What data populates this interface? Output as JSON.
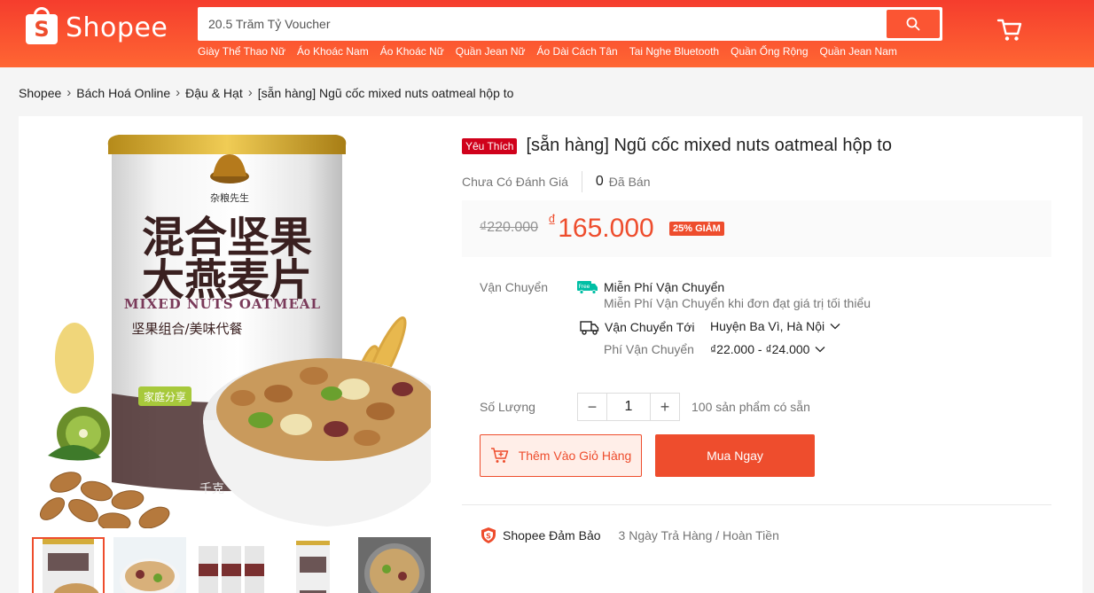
{
  "header": {
    "logo_letter": "S",
    "logo_text": "Shopee",
    "search_placeholder": "20.5 Trăm Tỷ Voucher",
    "keywords": [
      "Giày Thể Thao Nữ",
      "Áo Khoác Nam",
      "Áo Khoác Nữ",
      "Quần Jean Nữ",
      "Áo Dài Cách Tân",
      "Tai Nghe Bluetooth",
      "Quần Ống Rộng",
      "Quần Jean Nam"
    ]
  },
  "breadcrumb": [
    "Shopee",
    "Bách Hoá Online",
    "Đậu & Hạt",
    "[sẵn hàng] Ngũ cốc mixed nuts oatmeal hộp to"
  ],
  "product": {
    "badge": "Yêu Thích",
    "title": "[sẵn hàng] Ngũ cốc mixed nuts oatmeal hộp to",
    "rating_text": "Chưa Có Đánh Giá",
    "sold_count": "0",
    "sold_label": "Đã Bán",
    "old_price": "₫220.000",
    "currency": "₫",
    "new_price": "165.000",
    "discount": "25% GIẢM",
    "image_text": {
      "brand": "杂粮先生",
      "cn_line1": "混合坚果",
      "cn_line2": "大燕麦片",
      "en": "MIXED NUTS OATMEAL",
      "sub": "坚果组合/美味代餐",
      "tag": "家庭分享",
      "weight": "千克"
    }
  },
  "shipping": {
    "label": "Vận Chuyển",
    "free_tag": "Free",
    "free_title": "Miễn Phí Vận Chuyển",
    "free_desc": "Miễn Phí Vận Chuyển khi đơn đạt giá trị tối thiểu",
    "to_label": "Vận Chuyển Tới",
    "to_value": "Huyện Ba Vì, Hà Nội",
    "fee_label": "Phí Vận Chuyển",
    "fee_value": "₫22.000 - ₫24.000"
  },
  "quantity": {
    "label": "Số Lượng",
    "value": "1",
    "stock": "100 sản phẩm có sẵn"
  },
  "buttons": {
    "add_to_cart": "Thêm Vào Giỏ Hàng",
    "buy_now": "Mua Ngay"
  },
  "guarantee": {
    "title": "Shopee Đảm Bảo",
    "desc": "3 Ngày Trả Hàng / Hoàn Tiền"
  },
  "colors": {
    "brand": "#ee4d2d",
    "badge": "#d0011b"
  }
}
